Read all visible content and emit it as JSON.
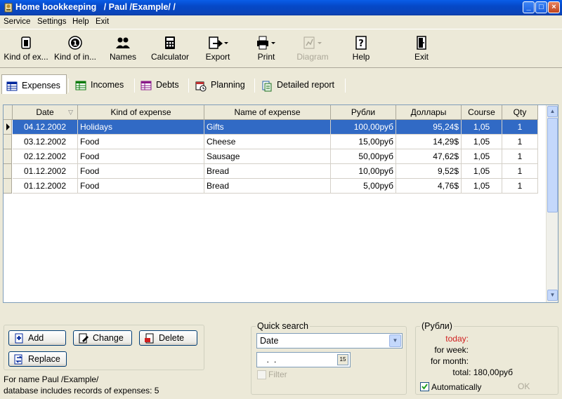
{
  "window": {
    "title": "Home bookkeeping   / Paul /Example/ /"
  },
  "menu": [
    "Service",
    "Settings",
    "Help",
    "Exit"
  ],
  "toolbar": [
    {
      "label": "Kind of ex...",
      "icon": "wallet-icon"
    },
    {
      "label": "Kind of in...",
      "icon": "coin-icon"
    },
    {
      "label": "Names",
      "icon": "people-icon"
    },
    {
      "label": "Calculator",
      "icon": "calculator-icon"
    },
    {
      "label": "Export",
      "icon": "export-icon"
    },
    {
      "label": "Print",
      "icon": "printer-icon"
    },
    {
      "label": "Diagram",
      "icon": "diagram-icon",
      "disabled": true
    },
    {
      "label": "Help",
      "icon": "help-icon"
    },
    {
      "label": "Exit",
      "icon": "exit-door-icon"
    }
  ],
  "tabs": [
    "Expenses",
    "Incomes",
    "Debts",
    "Planning",
    "Detailed report"
  ],
  "table": {
    "columns": [
      "Date",
      "Kind of expense",
      "Name of expense",
      "Рубли",
      "Доллары",
      "Course",
      "Qty"
    ],
    "rows": [
      [
        "04.12.2002",
        "Holidays",
        "Gifts",
        "100,00руб",
        "95,24$",
        "1,05",
        "1"
      ],
      [
        "03.12.2002",
        "Food",
        "Cheese",
        "15,00руб",
        "14,29$",
        "1,05",
        "1"
      ],
      [
        "02.12.2002",
        "Food",
        "Sausage",
        "50,00руб",
        "47,62$",
        "1,05",
        "1"
      ],
      [
        "01.12.2002",
        "Food",
        "Bread",
        "10,00руб",
        "9,52$",
        "1,05",
        "1"
      ],
      [
        "01.12.2002",
        "Food",
        "Bread",
        "5,00руб",
        "4,76$",
        "1,05",
        "1"
      ]
    ]
  },
  "actions": {
    "add": "Add",
    "change": "Change",
    "delete": "Delete",
    "replace": "Replace"
  },
  "status": {
    "line1": "For name Paul /Example/",
    "line2": "database includes records of expenses: 5"
  },
  "quick_search": {
    "title": "Quick search",
    "field": "Date",
    "date_value": " .  .",
    "filter_label": "Filter"
  },
  "totals": {
    "title": "(Рубли)",
    "today": "today:",
    "week": "for week:",
    "month": "for month:",
    "total": "total: 180,00руб",
    "auto_label": "Automatically",
    "ok_label": "OK"
  }
}
